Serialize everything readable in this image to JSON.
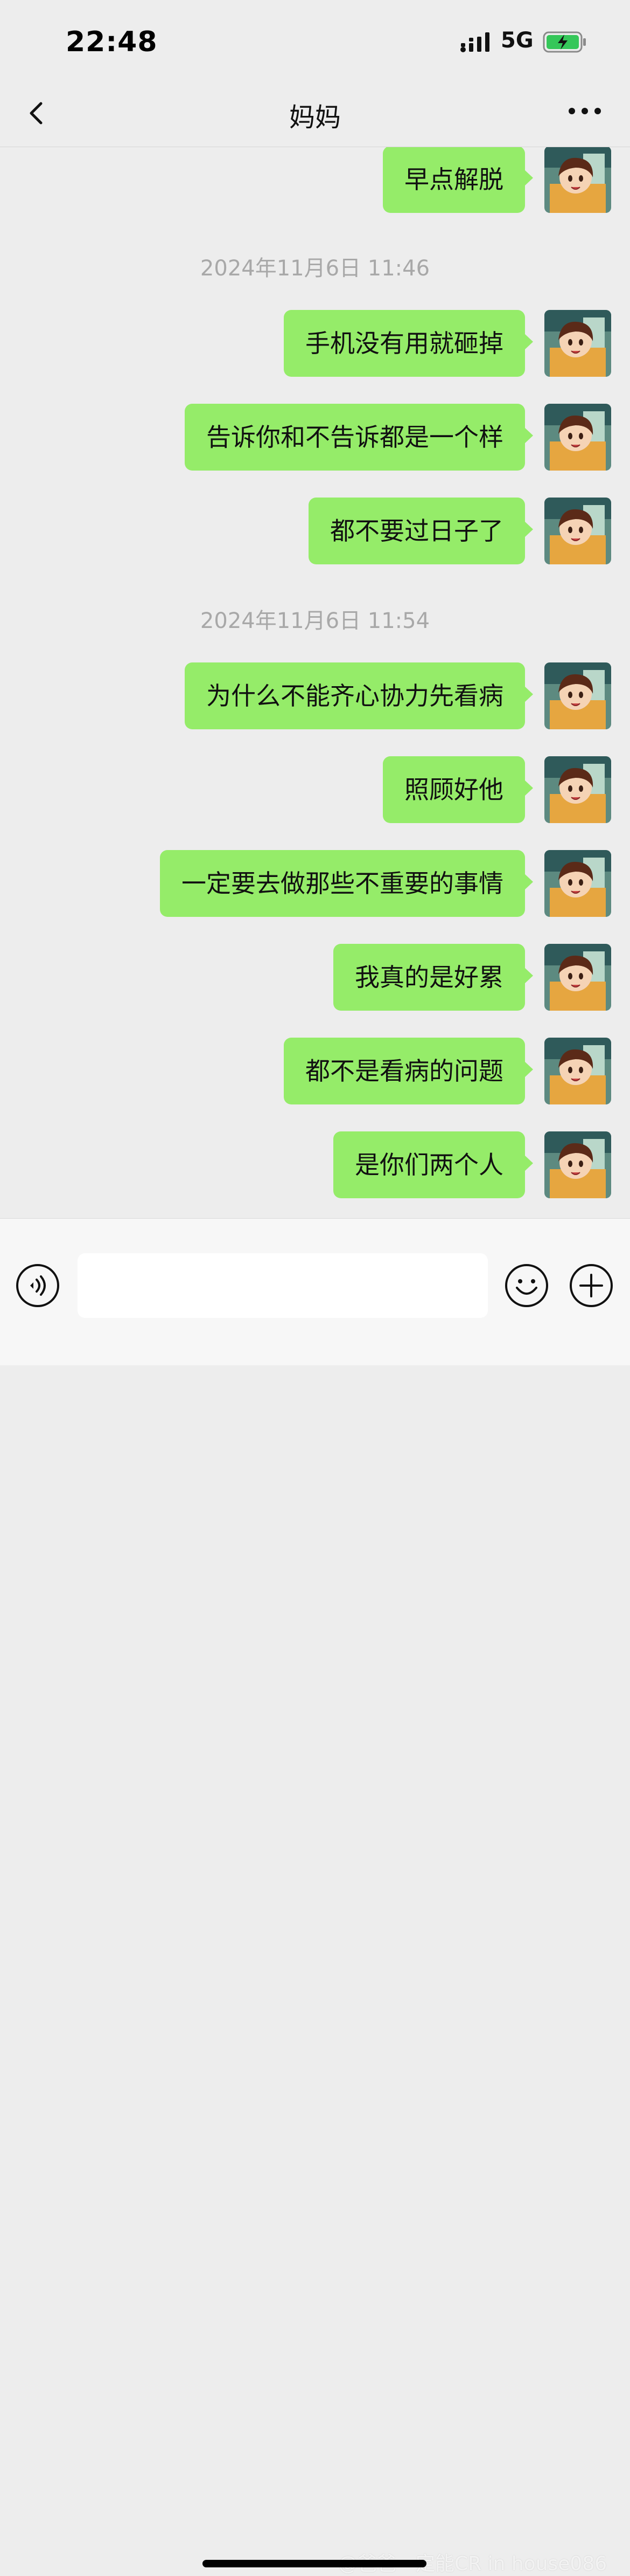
{
  "status_bar": {
    "time": "22:48",
    "network": "5G"
  },
  "header": {
    "title": "妈妈",
    "back_icon": "chevron-left-icon",
    "more_icon": "ellipsis-icon"
  },
  "messages": [
    {
      "type": "text",
      "text": "早点解脱",
      "sender": "me"
    },
    {
      "type": "time",
      "text": "2024年11月6日 11:46"
    },
    {
      "type": "text",
      "text": "手机没有用就砸掉",
      "sender": "me"
    },
    {
      "type": "text",
      "text": "告诉你和不告诉都是一个样",
      "sender": "me"
    },
    {
      "type": "text",
      "text": "都不要过日子了",
      "sender": "me"
    },
    {
      "type": "time",
      "text": "2024年11月6日 11:54"
    },
    {
      "type": "text",
      "text": "为什么不能齐心协力先看病",
      "sender": "me"
    },
    {
      "type": "text",
      "text": "照顾好他",
      "sender": "me"
    },
    {
      "type": "text",
      "text": "一定要去做那些不重要的事情",
      "sender": "me"
    },
    {
      "type": "text",
      "text": "我真的是好累",
      "sender": "me"
    },
    {
      "type": "text",
      "text": "都不是看病的问题",
      "sender": "me"
    },
    {
      "type": "text",
      "text": "是你们两个人",
      "sender": "me"
    }
  ],
  "input_bar": {
    "value": "",
    "voice_icon": "voice-icon",
    "emoji_icon": "emoji-icon",
    "plus_icon": "plus-icon"
  },
  "watermark": "@爸爸一定能CR in house086",
  "colors": {
    "background": "#ededed",
    "bubble": "#95ec69",
    "timestamp": "#a8a8a8",
    "input_bar": "#f7f7f7"
  }
}
